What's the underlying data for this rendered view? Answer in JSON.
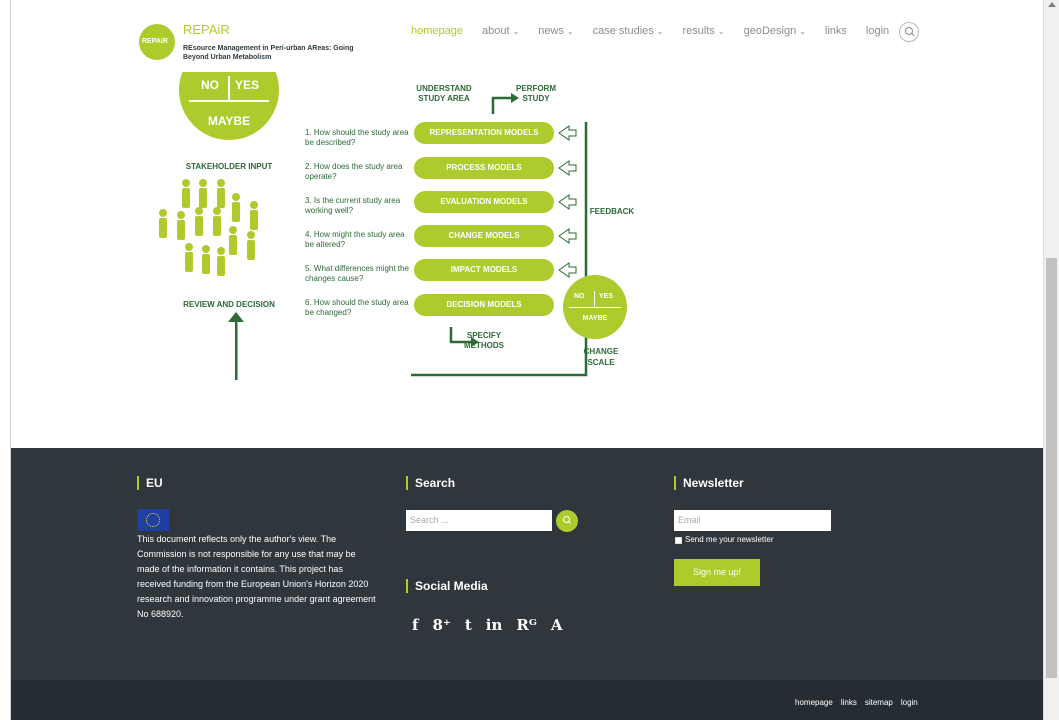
{
  "header": {
    "brand_title": "REPAiR",
    "logo_text": "REPAiR",
    "brand_subtitle": "REsource Management in Peri-urban AReas: Going Beyond Urban Metabolism",
    "nav": [
      {
        "label": "homepage",
        "active": true
      },
      {
        "label": "about",
        "dropdown": true
      },
      {
        "label": "news",
        "dropdown": true
      },
      {
        "label": "case studies",
        "dropdown": true
      },
      {
        "label": "results",
        "dropdown": true
      },
      {
        "label": "geoDesign",
        "dropdown": true
      },
      {
        "label": "links"
      },
      {
        "label": "login"
      }
    ]
  },
  "diagram": {
    "big_circle": {
      "no": "NO",
      "yes": "YES",
      "maybe": "MAYBE"
    },
    "stakeholder_input": "STAKEHOLDER INPUT",
    "review_decision": "REVIEW AND DECISION",
    "understand": "UNDERSTAND STUDY AREA",
    "perform": "PERFORM STUDY",
    "specify": "SPECIFY METHODS",
    "feedback": "FEEDBACK",
    "change_scale": "CHANGE SCALE",
    "questions": [
      "1. How should the study area be described?",
      "2. How does the study area operate?",
      "3. Is the current study area working well?",
      "4. How might the study area be altered?",
      "5. What differences might the changes cause?",
      "6. How should the study area be changed?"
    ],
    "models": [
      "REPRESENTATION MODELS",
      "PROCESS MODELS",
      "EVALUATION MODELS",
      "CHANGE MODELS",
      "IMPACT MODELS",
      "DECISION MODELS"
    ],
    "small_circle": {
      "no": "NO",
      "yes": "YES",
      "maybe": "MAYBE"
    }
  },
  "footer": {
    "eu_title": "EU",
    "eu_text": "This document reflects only the author's view. The Commission is not responsible for any use that may be made of the information it contains. This project has received funding from the European Union's Horizon 2020 research and innovation programme under grant agreement No 688920.",
    "search_title": "Search",
    "search_placeholder": "Search ...",
    "social_title": "Social Media",
    "social_icons": [
      "facebook-icon",
      "google-plus-icon",
      "twitter-icon",
      "linkedin-icon",
      "researchgate-icon",
      "academia-icon"
    ],
    "social_glyphs": [
      "f",
      "8⁺",
      "t",
      "in",
      "Rᴳ",
      "A"
    ],
    "newsletter_title": "Newsletter",
    "email_placeholder": "Email",
    "checkbox_label": "Send me your newsletter",
    "signup_label": "Sign me up!",
    "bottom_links": [
      "homepage",
      "links",
      "sitemap",
      "login"
    ]
  },
  "colors": {
    "accent": "#aecb2e",
    "dark_green": "#2d6a36",
    "footer_bg": "#2f373d",
    "bottom_bg": "#262d32"
  }
}
